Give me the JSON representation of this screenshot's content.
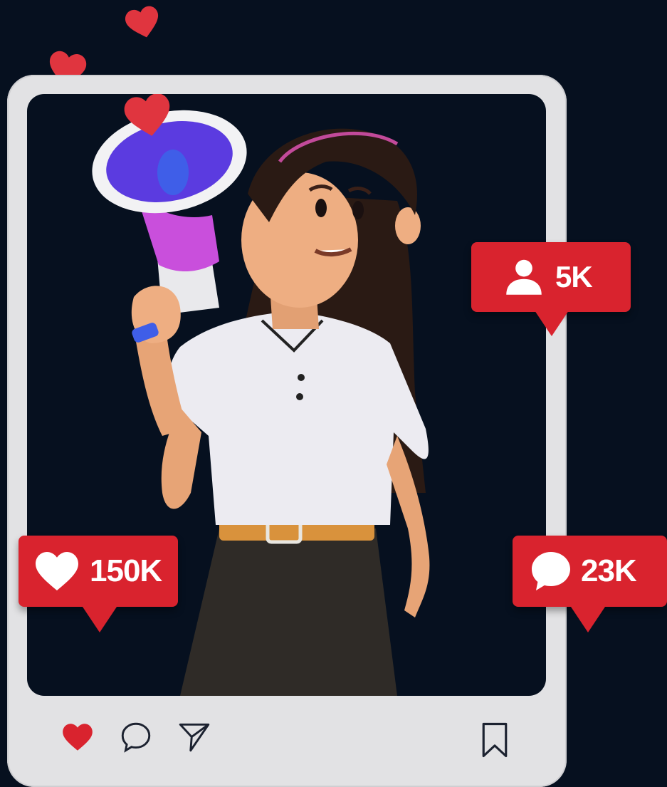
{
  "badges": {
    "followers": {
      "icon": "user-icon",
      "value": "5K"
    },
    "likes": {
      "icon": "heart-icon",
      "value": "150K"
    },
    "comments": {
      "icon": "comment-icon",
      "value": "23K"
    }
  },
  "post_actions": [
    {
      "icon": "heart-icon",
      "state": "liked"
    },
    {
      "icon": "comment-icon"
    },
    {
      "icon": "send-icon"
    },
    {
      "icon": "bookmark-icon"
    }
  ],
  "colors": {
    "background": "#06101f",
    "frame": "#e2e2e4",
    "accent_red": "#d9232e"
  }
}
